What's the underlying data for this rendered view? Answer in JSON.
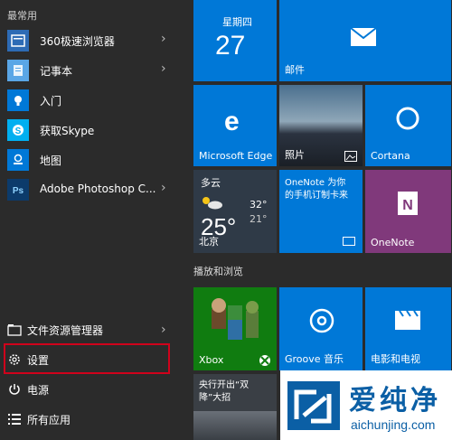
{
  "left": {
    "section": "最常用",
    "apps": [
      {
        "label": "360极速浏览器",
        "icon": "browser-icon",
        "chev": "›"
      },
      {
        "label": "记事本",
        "icon": "notepad-icon",
        "chev": "›"
      },
      {
        "label": "入门",
        "icon": "lightbulb-icon",
        "chev": ""
      },
      {
        "label": "获取Skype",
        "icon": "skype-icon",
        "chev": ""
      },
      {
        "label": "地图",
        "icon": "map-icon",
        "chev": ""
      },
      {
        "label": "Adobe Photoshop C...",
        "icon": "photoshop-icon",
        "chev": "›"
      }
    ],
    "bottom": [
      {
        "label": "文件资源管理器",
        "icon": "file-explorer-icon",
        "chev": "›"
      },
      {
        "label": "设置",
        "icon": "gear-icon",
        "chev": ""
      },
      {
        "label": "电源",
        "icon": "power-icon",
        "chev": ""
      },
      {
        "label": "所有应用",
        "icon": "all-apps-icon",
        "chev": ""
      }
    ]
  },
  "tiles": {
    "calendar": {
      "day": "星期四",
      "date": "27"
    },
    "mail": {
      "label": "邮件"
    },
    "edge": {
      "label": "Microsoft Edge"
    },
    "photos": {
      "label": "照片"
    },
    "cortana": {
      "label": "Cortana"
    },
    "weather": {
      "cond": "多云",
      "temp": "25°",
      "high": "32°",
      "low": "21°",
      "city": "北京"
    },
    "onenote_promo": {
      "text": "OneNote 为你\n的手机订制卡来"
    },
    "onenote": {
      "label": "OneNote"
    },
    "group2": "播放和浏览",
    "xbox": {
      "label": "Xbox"
    },
    "groove": {
      "label": "Groove 音乐"
    },
    "movies": {
      "label": "电影和电视"
    },
    "news": {
      "text": "央行开出“双\n降”大招"
    }
  },
  "watermark": {
    "cn": "爱纯净",
    "url": "aichunjing.com"
  },
  "colors": {
    "accent": "#0078d7",
    "highlight": "#d0021b",
    "onenote": "#80397b",
    "xbox": "#107c10"
  }
}
